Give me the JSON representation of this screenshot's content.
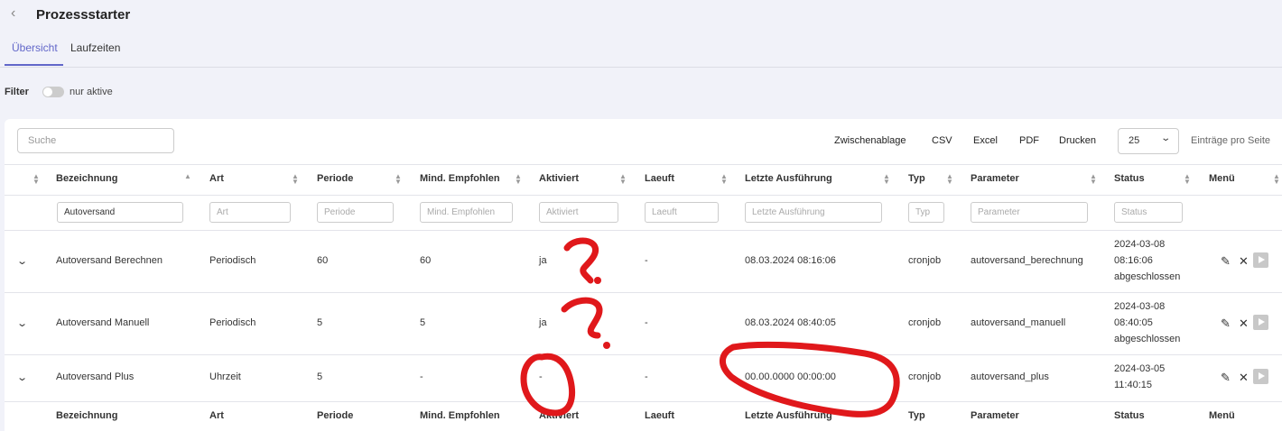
{
  "page": {
    "title": "Prozessstarter"
  },
  "tabs": [
    {
      "label": "Übersicht"
    },
    {
      "label": "Laufzeiten"
    }
  ],
  "filter": {
    "label": "Filter",
    "toggle_label": "nur aktive"
  },
  "search": {
    "placeholder": "Suche"
  },
  "exports": [
    "Zwischenablage",
    "CSV",
    "Excel",
    "PDF",
    "Drucken"
  ],
  "pagination": {
    "per_page": "25",
    "label": "Einträge pro Seite"
  },
  "columns": [
    "Bezeichnung",
    "Art",
    "Periode",
    "Mind. Empfohlen",
    "Aktiviert",
    "Laeuft",
    "Letzte Ausführung",
    "Typ",
    "Parameter",
    "Status",
    "Menü"
  ],
  "column_filters": {
    "bezeichnung_value": "Autoversand",
    "art": "Art",
    "periode": "Periode",
    "mind": "Mind. Empfohlen",
    "aktiviert": "Aktiviert",
    "laeuft": "Laeuft",
    "letzte": "Letzte Ausführung",
    "typ": "Typ",
    "parameter": "Parameter",
    "status": "Status"
  },
  "rows": [
    {
      "name": "Autoversand Berechnen",
      "art": "Periodisch",
      "periode": "60",
      "mind": "60",
      "aktiviert": "ja",
      "laeuft": "-",
      "letzte": "08.03.2024 08:16:06",
      "typ": "cronjob",
      "parameter": "autoversand_berechnung",
      "status": [
        "2024-03-08",
        "08:16:06",
        "abgeschlossen"
      ]
    },
    {
      "name": "Autoversand Manuell",
      "art": "Periodisch",
      "periode": "5",
      "mind": "5",
      "aktiviert": "ja",
      "laeuft": "-",
      "letzte": "08.03.2024 08:40:05",
      "typ": "cronjob",
      "parameter": "autoversand_manuell",
      "status": [
        "2024-03-08",
        "08:40:05",
        "abgeschlossen"
      ]
    },
    {
      "name": "Autoversand Plus",
      "art": "Uhrzeit",
      "periode": "5",
      "mind": "-",
      "aktiviert": "-",
      "laeuft": "-",
      "letzte": "00.00.0000 00:00:00",
      "typ": "cronjob",
      "parameter": "autoversand_plus",
      "status": [
        "2024-03-05",
        "11:40:15"
      ]
    }
  ],
  "annotation_color": "#e0181b",
  "accent_color": "#6267c9"
}
